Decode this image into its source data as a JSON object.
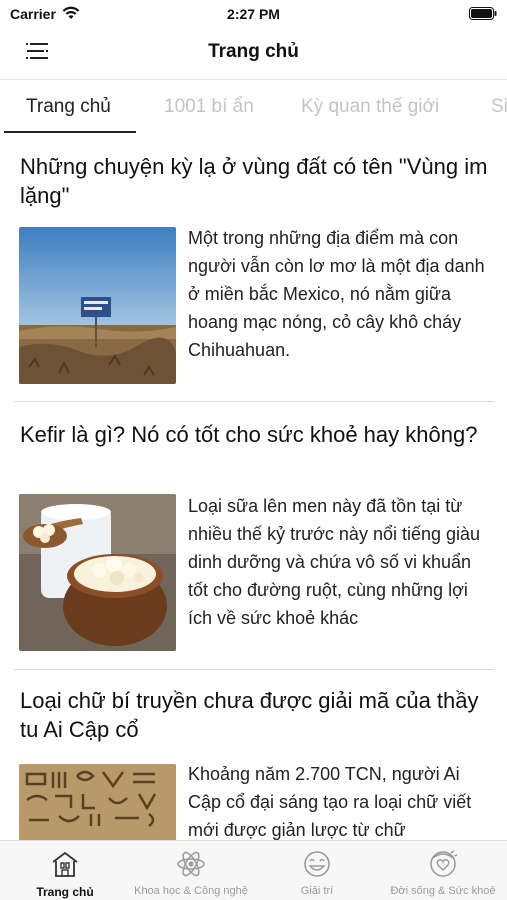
{
  "status_bar": {
    "carrier": "Carrier",
    "time": "2:27 PM"
  },
  "nav": {
    "title": "Trang chủ"
  },
  "tabs": [
    {
      "label": "Trang chủ",
      "active": true
    },
    {
      "label": "1001 bí ẩn",
      "active": false
    },
    {
      "label": "Kỳ quan thế giới",
      "active": false
    },
    {
      "label": "Si",
      "active": false
    }
  ],
  "articles": [
    {
      "title": "Những chuyện kỳ lạ ở vùng đất có tên \"Vùng im lặng\"",
      "summary": "Một trong những địa điểm mà con người vẫn còn lơ mơ là một địa danh ở miền bắc Mexico, nó nằm giữa hoang mạc nóng, cỏ cây khô cháy Chihuahuan.",
      "image": "desert-sign-photo"
    },
    {
      "title": "Kefir là gì? Nó có tốt cho sức khoẻ hay không?",
      "summary": "Loại sữa lên men này đã tồn tại từ nhiều thế kỷ trước này nổi tiếng giàu dinh dưỡng và chứa vô số vi khuẩn tốt cho đường ruột, cùng những lợi ích về sức khoẻ khác",
      "image": "kefir-bowl-photo"
    },
    {
      "title": "Loại chữ bí truyền chưa được giải mã của thầy tu Ai Cập cổ",
      "summary": "Khoảng năm 2.700 TCN, người Ai Cập cổ đại sáng tạo ra loại chữ viết mới được giản lược từ chữ",
      "image": "hieroglyph-photo"
    }
  ],
  "tab_bar": [
    {
      "label": "Trang chủ",
      "icon": "home-icon",
      "active": true
    },
    {
      "label": "Khoa học & Công nghệ",
      "icon": "atom-icon",
      "active": false
    },
    {
      "label": "Giải trí",
      "icon": "smile-icon",
      "active": false
    },
    {
      "label": "Đời sống & Sức khoẻ",
      "icon": "health-icon",
      "active": false
    }
  ],
  "colors": {
    "active_text": "#222222",
    "inactive_tab": "#c4c4c4",
    "tabbar_bg": "#f7f7f7"
  }
}
